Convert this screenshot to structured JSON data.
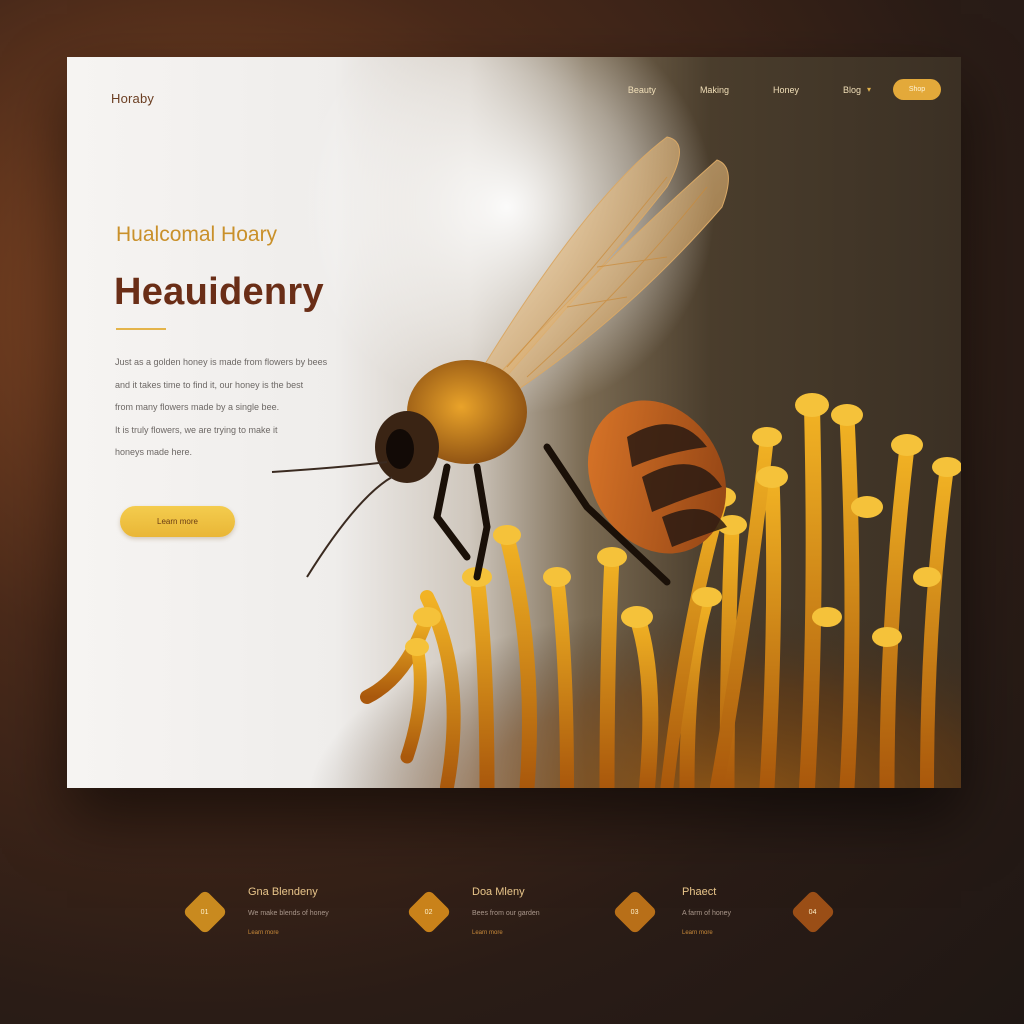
{
  "header": {
    "brand": "Horaby",
    "nav_links": [
      "Beauty",
      "Making",
      "Honey",
      "Blog"
    ],
    "nav_button": "Shop"
  },
  "hero": {
    "eyebrow": "Hualcomal Hoary",
    "headline": "Heauidenry",
    "body_lines": [
      "Just as a golden honey is made from flowers by bees",
      "and it takes time to find it, our honey is the best",
      "from many flowers made by a single bee.",
      "It is truly flowers, we are trying to make it",
      "honeys made here."
    ],
    "cta_label": "Learn more"
  },
  "features": [
    {
      "badge": "01",
      "title": "Gna Blendeny",
      "desc": "We make blends of honey",
      "link": "Learn more"
    },
    {
      "badge": "02",
      "title": "Doa Mleny",
      "desc": "Bees from our garden",
      "link": "Learn more"
    },
    {
      "badge": "03",
      "title": "Phaect",
      "desc": "A farm of honey",
      "link": "Learn more"
    },
    {
      "badge": "04"
    }
  ],
  "colors": {
    "accent": "#e3a93a",
    "headline": "#6a2e17",
    "eyebrow": "#c9902a",
    "diamond_1": "#c98a1f",
    "diamond_2": "#c9821a",
    "diamond_3": "#b86f18",
    "diamond_4": "#9a4e16"
  }
}
